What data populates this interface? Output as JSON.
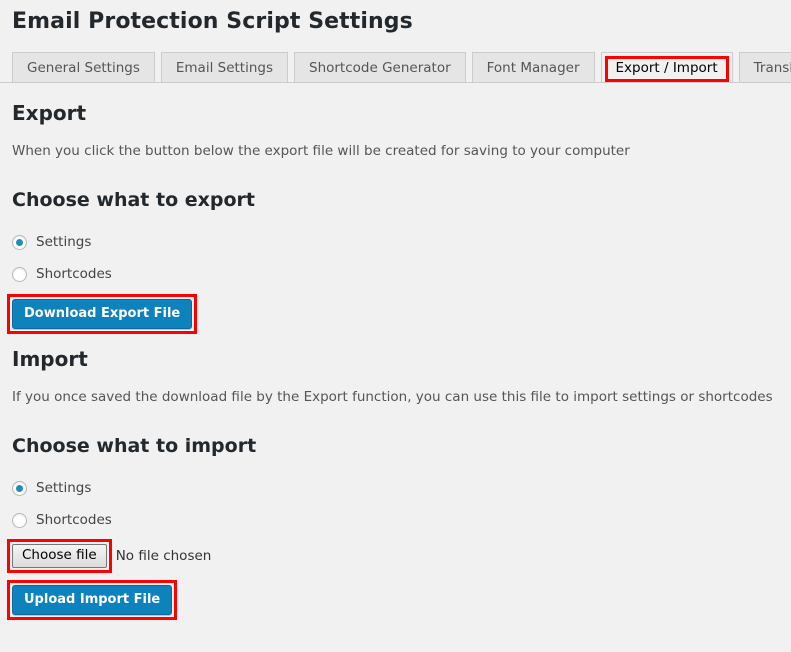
{
  "page": {
    "title": "Email Protection Script Settings"
  },
  "tabs": [
    {
      "label": "General Settings",
      "active": false,
      "highlighted": false
    },
    {
      "label": "Email Settings",
      "active": false,
      "highlighted": false
    },
    {
      "label": "Shortcode Generator",
      "active": false,
      "highlighted": false
    },
    {
      "label": "Font Manager",
      "active": false,
      "highlighted": false
    },
    {
      "label": "Export / Import",
      "active": true,
      "highlighted": true
    },
    {
      "label": "Translation",
      "active": false,
      "highlighted": false
    }
  ],
  "export": {
    "heading": "Export",
    "description": "When you click the button below the export file will be created for saving to your computer",
    "choose_heading": "Choose what to export",
    "options": [
      {
        "label": "Settings",
        "checked": true
      },
      {
        "label": "Shortcodes",
        "checked": false
      }
    ],
    "button_label": "Download Export File"
  },
  "import": {
    "heading": "Import",
    "description": "If you once saved the download file by the Export function, you can use this file to import settings or shortcodes",
    "choose_heading": "Choose what to import",
    "options": [
      {
        "label": "Settings",
        "checked": true
      },
      {
        "label": "Shortcodes",
        "checked": false
      }
    ],
    "file_button_label": "Choose file",
    "file_status": "No file chosen",
    "button_label": "Upload Import File"
  },
  "colors": {
    "background": "#f1f1f1",
    "primary_button": "#0d82bd",
    "highlight_ring": "#ff0000",
    "tab_inactive": "#e5e5e5",
    "radio_dot": "#1e8cbe"
  }
}
